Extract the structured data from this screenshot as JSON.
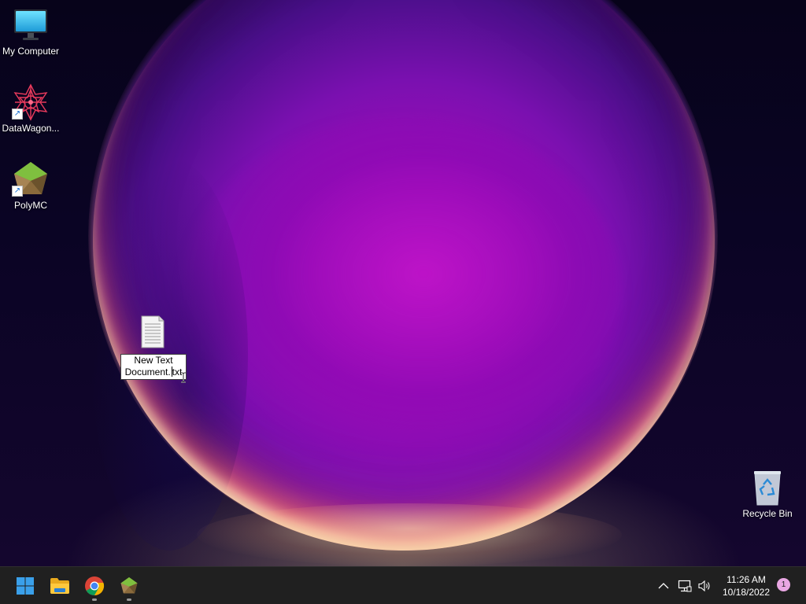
{
  "desktop": {
    "icons": [
      {
        "label": "My Computer",
        "icon": "monitor-icon",
        "shortcut": false
      },
      {
        "label": "DataWagon...",
        "icon": "datawagon-icon",
        "shortcut": true
      },
      {
        "label": "PolyMC",
        "icon": "polymc-icon",
        "shortcut": true
      },
      {
        "label": "Recycle Bin",
        "icon": "recycle-bin-icon",
        "shortcut": false
      }
    ],
    "renaming_file": {
      "icon": "text-document-icon",
      "line1": "New Text",
      "line2_before_caret": "Document.",
      "line2_after_caret": "txt"
    }
  },
  "taskbar": {
    "apps": [
      {
        "name": "start-button",
        "icon": "windows-logo-icon",
        "running": false
      },
      {
        "name": "file-explorer",
        "icon": "folder-icon",
        "running": false
      },
      {
        "name": "chrome",
        "icon": "chrome-icon",
        "running": true
      },
      {
        "name": "polymc",
        "icon": "polymc-icon",
        "running": true
      }
    ],
    "tray": {
      "icons": [
        "chevron-up-icon",
        "network-icon",
        "volume-icon"
      ],
      "time": "11:26 AM",
      "date": "10/18/2022",
      "notification_count": "1"
    }
  },
  "colors": {
    "taskbar_bg": "#202020",
    "accent_blue": "#0078d4",
    "notification_badge": "#e9a7e3"
  }
}
